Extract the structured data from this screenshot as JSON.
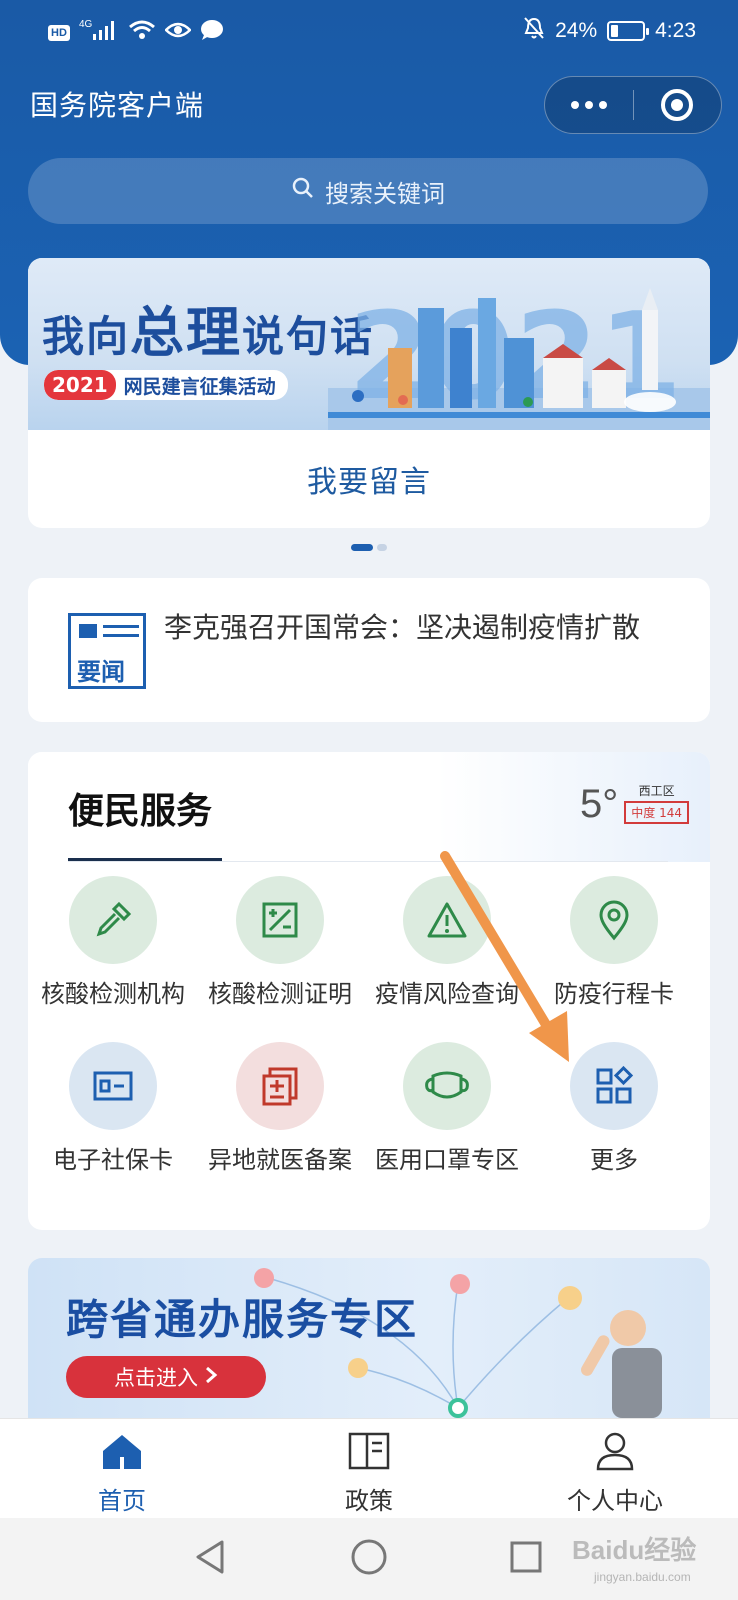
{
  "status_bar": {
    "hd": "HD",
    "network": "4G",
    "battery": "24%",
    "battery_level": 0.24,
    "time": "4:23"
  },
  "header": {
    "title": "国务院客户端",
    "search_placeholder": "搜索关键词"
  },
  "banner": {
    "headline_a": "我向",
    "headline_b": "总理",
    "headline_c": "说句话",
    "year": "2021",
    "campaign": "网民建言征集活动",
    "art_label": "2021",
    "action": "我要留言",
    "pages": 2,
    "active_page": 1
  },
  "news": {
    "tag": "要闻",
    "headline": "李克强召开国常会：坚决遏制疫情扩散"
  },
  "services": {
    "title": "便民服务",
    "weather": {
      "temp": "5°",
      "district": "西工区",
      "aqi": "中度 144",
      "aqi_color": "#d23b3b"
    },
    "items": [
      {
        "label": "核酸检测机构",
        "icon": "dropper-icon"
      },
      {
        "label": "核酸检测证明",
        "icon": "certificate-icon"
      },
      {
        "label": "疫情风险查询",
        "icon": "warning-icon"
      },
      {
        "label": "防疫行程卡",
        "icon": "location-pin-icon"
      },
      {
        "label": "电子社保卡",
        "icon": "id-card-icon"
      },
      {
        "label": "异地就医备案",
        "icon": "medical-record-icon"
      },
      {
        "label": "医用口罩专区",
        "icon": "mask-icon"
      },
      {
        "label": "更多",
        "icon": "grid-more-icon"
      }
    ]
  },
  "promo": {
    "title": "跨省通办服务专区",
    "button": "点击进入"
  },
  "tabbar": {
    "items": [
      {
        "label": "首页",
        "active": true
      },
      {
        "label": "政策",
        "active": false
      },
      {
        "label": "个人中心",
        "active": false
      }
    ]
  },
  "watermark": {
    "text": "Baidu经验",
    "sub": "jingyan.baidu.com"
  },
  "colors": {
    "brand_blue": "#1b5eae",
    "accent_red": "#d8323c",
    "arrow_orange": "#f0964a"
  }
}
